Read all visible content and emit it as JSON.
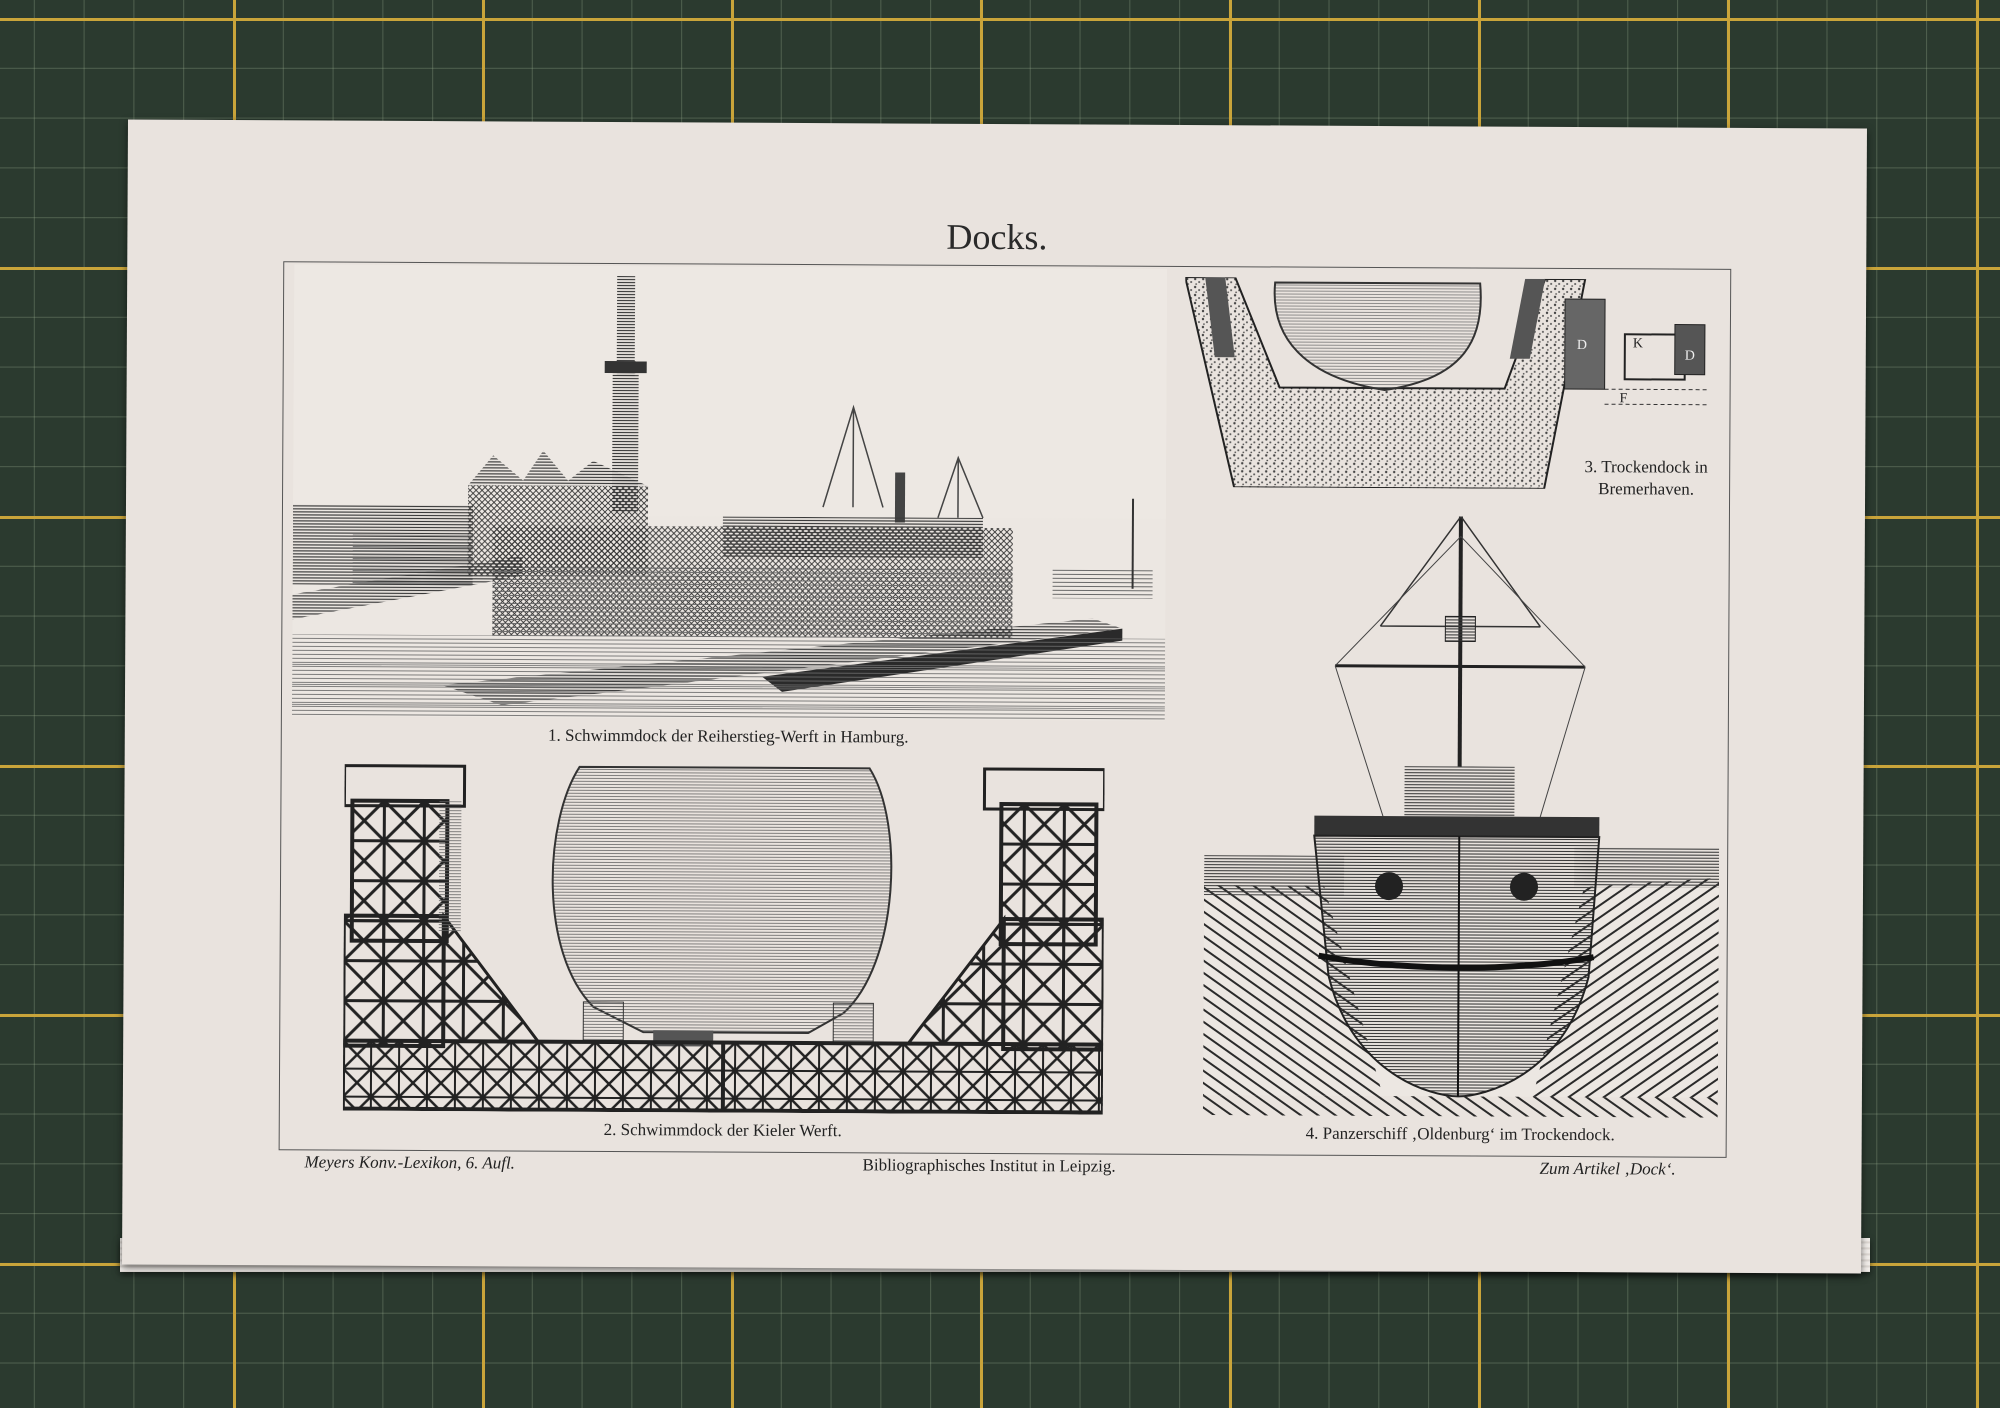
{
  "title": "Docks.",
  "figures": [
    {
      "caption": "1. Schwimmdock der Reiherstieg-Werft in Hamburg."
    },
    {
      "caption": "2. Schwimmdock der Kieler Werft."
    },
    {
      "caption_line1": "3. Trockendock in",
      "caption_line2": "Bremerhaven.",
      "labels": [
        "D",
        "K",
        "D",
        "F"
      ]
    },
    {
      "caption": "4. Panzerschiff ‚Oldenburg‘ im Trockendock."
    }
  ],
  "footer": {
    "left": "Meyers Konv.-Lexikon, 6. Aufl.",
    "center": "Bibliographisches Institut in Leipzig.",
    "right": "Zum Artikel ‚Dock‘."
  }
}
